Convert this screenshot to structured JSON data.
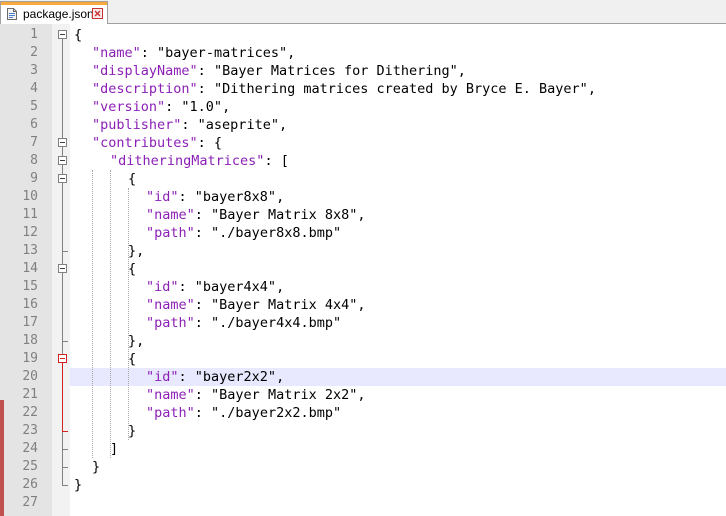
{
  "tab": {
    "filename": "package.json"
  },
  "colors": {
    "tab_accent": "#f7a93b",
    "key": "#8b1fb6",
    "current_line": "#e8e8ff",
    "fold_active": "#d02020"
  },
  "lines": [
    {
      "n": "1",
      "indent": 0,
      "parts": [
        [
          "pun",
          "{"
        ]
      ]
    },
    {
      "n": "2",
      "indent": 1,
      "parts": [
        [
          "key",
          "\"name\""
        ],
        [
          "pun",
          ": "
        ],
        [
          "str",
          "\"bayer-matrices\""
        ],
        [
          "pun",
          ","
        ]
      ]
    },
    {
      "n": "3",
      "indent": 1,
      "parts": [
        [
          "key",
          "\"displayName\""
        ],
        [
          "pun",
          ": "
        ],
        [
          "str",
          "\"Bayer Matrices for Dithering\""
        ],
        [
          "pun",
          ","
        ]
      ]
    },
    {
      "n": "4",
      "indent": 1,
      "parts": [
        [
          "key",
          "\"description\""
        ],
        [
          "pun",
          ": "
        ],
        [
          "str",
          "\"Dithering matrices created by Bryce E. Bayer\""
        ],
        [
          "pun",
          ","
        ]
      ]
    },
    {
      "n": "5",
      "indent": 1,
      "parts": [
        [
          "key",
          "\"version\""
        ],
        [
          "pun",
          ": "
        ],
        [
          "str",
          "\"1.0\""
        ],
        [
          "pun",
          ","
        ]
      ]
    },
    {
      "n": "6",
      "indent": 1,
      "parts": [
        [
          "key",
          "\"publisher\""
        ],
        [
          "pun",
          ": "
        ],
        [
          "str",
          "\"aseprite\""
        ],
        [
          "pun",
          ","
        ]
      ]
    },
    {
      "n": "7",
      "indent": 1,
      "parts": [
        [
          "key",
          "\"contributes\""
        ],
        [
          "pun",
          ": {"
        ]
      ]
    },
    {
      "n": "8",
      "indent": 2,
      "parts": [
        [
          "key",
          "\"ditheringMatrices\""
        ],
        [
          "pun",
          ": ["
        ]
      ]
    },
    {
      "n": "9",
      "indent": 3,
      "parts": [
        [
          "pun",
          "{"
        ]
      ]
    },
    {
      "n": "10",
      "indent": 4,
      "parts": [
        [
          "key",
          "\"id\""
        ],
        [
          "pun",
          ": "
        ],
        [
          "str",
          "\"bayer8x8\""
        ],
        [
          "pun",
          ","
        ]
      ]
    },
    {
      "n": "11",
      "indent": 4,
      "parts": [
        [
          "key",
          "\"name\""
        ],
        [
          "pun",
          ": "
        ],
        [
          "str",
          "\"Bayer Matrix 8x8\""
        ],
        [
          "pun",
          ","
        ]
      ]
    },
    {
      "n": "12",
      "indent": 4,
      "parts": [
        [
          "key",
          "\"path\""
        ],
        [
          "pun",
          ": "
        ],
        [
          "str",
          "\"./bayer8x8.bmp\""
        ]
      ]
    },
    {
      "n": "13",
      "indent": 3,
      "parts": [
        [
          "pun",
          "},"
        ]
      ]
    },
    {
      "n": "14",
      "indent": 3,
      "parts": [
        [
          "pun",
          "{"
        ]
      ]
    },
    {
      "n": "15",
      "indent": 4,
      "parts": [
        [
          "key",
          "\"id\""
        ],
        [
          "pun",
          ": "
        ],
        [
          "str",
          "\"bayer4x4\""
        ],
        [
          "pun",
          ","
        ]
      ]
    },
    {
      "n": "16",
      "indent": 4,
      "parts": [
        [
          "key",
          "\"name\""
        ],
        [
          "pun",
          ": "
        ],
        [
          "str",
          "\"Bayer Matrix 4x4\""
        ],
        [
          "pun",
          ","
        ]
      ]
    },
    {
      "n": "17",
      "indent": 4,
      "parts": [
        [
          "key",
          "\"path\""
        ],
        [
          "pun",
          ": "
        ],
        [
          "str",
          "\"./bayer4x4.bmp\""
        ]
      ]
    },
    {
      "n": "18",
      "indent": 3,
      "parts": [
        [
          "pun",
          "},"
        ]
      ]
    },
    {
      "n": "19",
      "indent": 3,
      "parts": [
        [
          "pun",
          "{"
        ]
      ]
    },
    {
      "n": "20",
      "indent": 4,
      "parts": [
        [
          "key",
          "\"id\""
        ],
        [
          "pun",
          ": "
        ],
        [
          "str",
          "\"bayer2x2\""
        ],
        [
          "pun",
          ","
        ]
      ]
    },
    {
      "n": "21",
      "indent": 4,
      "parts": [
        [
          "key",
          "\"name\""
        ],
        [
          "pun",
          ": "
        ],
        [
          "str",
          "\"Bayer Matrix 2x2\""
        ],
        [
          "pun",
          ","
        ]
      ]
    },
    {
      "n": "22",
      "indent": 4,
      "parts": [
        [
          "key",
          "\"path\""
        ],
        [
          "pun",
          ": "
        ],
        [
          "str",
          "\"./bayer2x2.bmp\""
        ]
      ]
    },
    {
      "n": "23",
      "indent": 3,
      "parts": [
        [
          "pun",
          "}"
        ]
      ]
    },
    {
      "n": "24",
      "indent": 2,
      "parts": [
        [
          "pun",
          "]"
        ]
      ]
    },
    {
      "n": "25",
      "indent": 1,
      "parts": [
        [
          "pun",
          "}"
        ]
      ]
    },
    {
      "n": "26",
      "indent": 0,
      "parts": [
        [
          "pun",
          "}"
        ]
      ]
    },
    {
      "n": "27",
      "indent": 0,
      "parts": []
    }
  ]
}
